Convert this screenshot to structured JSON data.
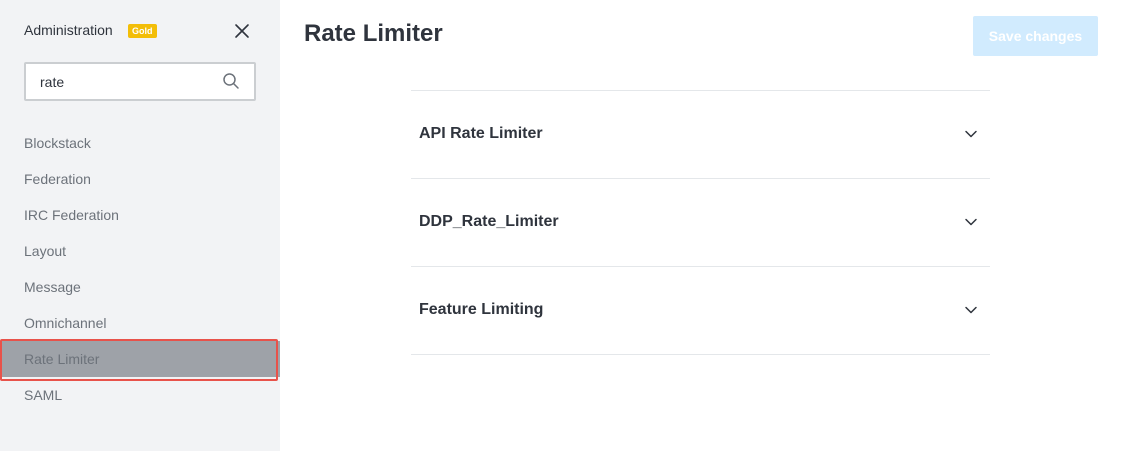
{
  "sidebar": {
    "title": "Administration",
    "badge": "Gold",
    "search": {
      "value": "rate",
      "placeholder": ""
    },
    "items": [
      {
        "label": "Blockstack"
      },
      {
        "label": "Federation"
      },
      {
        "label": "IRC Federation"
      },
      {
        "label": "Layout"
      },
      {
        "label": "Message"
      },
      {
        "label": "Omnichannel"
      },
      {
        "label": "Rate Limiter",
        "active": true
      },
      {
        "label": "SAML"
      }
    ]
  },
  "main": {
    "title": "Rate Limiter",
    "save_label": "Save changes",
    "sections": [
      {
        "title": "API Rate Limiter"
      },
      {
        "title": "DDP_Rate_Limiter"
      },
      {
        "title": "Feature Limiting"
      }
    ]
  },
  "icons": {
    "close": "close-icon",
    "search": "search-icon",
    "chevron": "chevron-down-icon"
  },
  "colors": {
    "sidebar_bg": "#f2f3f5",
    "active_item_bg": "#9ea2a8",
    "highlight_border": "#e8524a",
    "badge_bg": "#f3be08",
    "save_button_bg": "#d1ebfe"
  }
}
